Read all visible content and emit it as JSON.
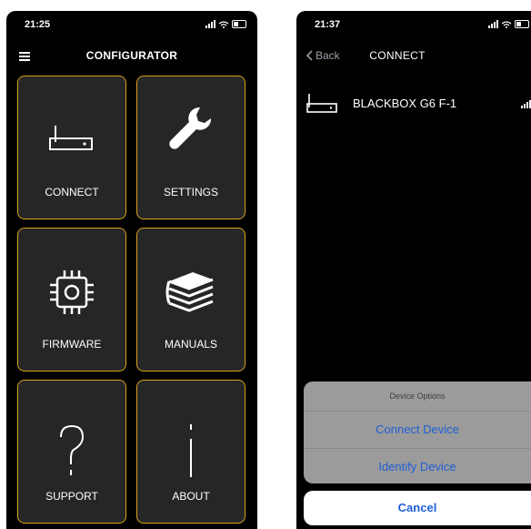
{
  "screen1": {
    "time": "21:25",
    "title": "CONFIGURATOR",
    "tiles": [
      {
        "label": "CONNECT",
        "icon": "router-icon"
      },
      {
        "label": "SETTINGS",
        "icon": "wrench-icon"
      },
      {
        "label": "FIRMWARE",
        "icon": "chip-icon"
      },
      {
        "label": "MANUALS",
        "icon": "books-icon"
      },
      {
        "label": "SUPPORT",
        "icon": "question-icon"
      },
      {
        "label": "ABOUT",
        "icon": "info-icon"
      }
    ],
    "accent_color": "#d9a21b"
  },
  "screen2": {
    "time": "21:37",
    "back_label": "Back",
    "title": "CONNECT",
    "device": {
      "name": "BLACKBOX G6 F-1"
    },
    "action_sheet": {
      "title": "Device Options",
      "options": [
        "Connect Device",
        "Identify Device"
      ],
      "cancel_label": "Cancel"
    },
    "link_color": "#1f5fd6"
  }
}
